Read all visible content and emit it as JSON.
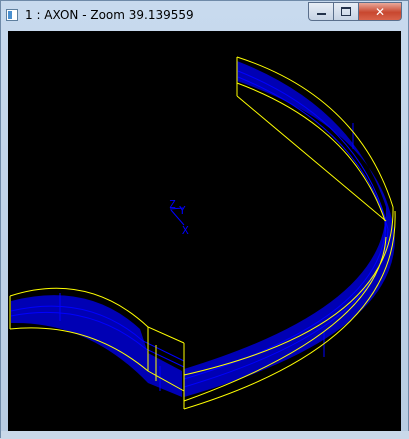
{
  "window": {
    "title": "1 : AXON - Zoom 39.139559",
    "controls": {
      "minimize": "minimize-icon",
      "maximize": "maximize-icon",
      "close": "close-icon"
    }
  },
  "viewport": {
    "background": "#000000",
    "axis_labels": {
      "z": "Z",
      "y": "Y",
      "x": "X"
    },
    "colors": {
      "outline": "#ffff00",
      "fill": "#0000b4",
      "inner_lines": "#0000ff",
      "axes": "#0000ff"
    }
  }
}
